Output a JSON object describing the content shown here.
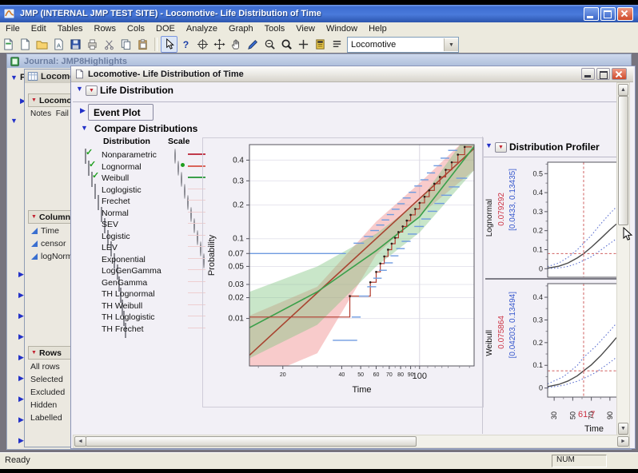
{
  "app": {
    "title": "JMP (INTERNAL JMP TEST SITE)  - Locomotive- Life Distribution of Time"
  },
  "menu": {
    "items": [
      "File",
      "Edit",
      "Tables",
      "Rows",
      "Cols",
      "DOE",
      "Analyze",
      "Graph",
      "Tools",
      "View",
      "Window",
      "Help"
    ]
  },
  "toolbar": {
    "table_selector_value": "Locomotive",
    "buttons": [
      {
        "name": "new-journal-button",
        "icon": "page-journal"
      },
      {
        "name": "new-data-table-button",
        "icon": "page"
      },
      {
        "name": "open-button",
        "icon": "folder"
      },
      {
        "name": "open-script-button",
        "icon": "page-a"
      },
      {
        "name": "save-button",
        "icon": "save"
      },
      {
        "name": "print-button",
        "icon": "print"
      },
      {
        "name": "cut-button",
        "icon": "scissors"
      },
      {
        "name": "copy-button",
        "icon": "copy"
      },
      {
        "name": "paste-button",
        "icon": "paste"
      },
      {
        "separator": true
      },
      {
        "name": "arrow-tool-button",
        "icon": "cursor",
        "selected": true
      },
      {
        "name": "help-tool-button",
        "icon": "help"
      },
      {
        "name": "crosshair-tool-button",
        "icon": "crosshair"
      },
      {
        "name": "move-tool-button",
        "icon": "move"
      },
      {
        "name": "grabber-tool-button",
        "icon": "hand"
      },
      {
        "name": "brush-tool-button",
        "icon": "brush"
      },
      {
        "name": "zoom-out-tool-button",
        "icon": "magnify-minus"
      },
      {
        "name": "zoom-tool-button",
        "icon": "magnify"
      },
      {
        "name": "plus-tool-button",
        "icon": "plus"
      },
      {
        "name": "formula-tool-button",
        "icon": "calculator"
      },
      {
        "name": "annotate-tool-button",
        "icon": "annotate"
      },
      {
        "name": "lasso-tool-button",
        "icon": "lasso"
      },
      {
        "name": "oval-tool-button",
        "icon": "oval"
      }
    ]
  },
  "journal_window": {
    "title": "Journal: JMP8Highlights",
    "outline_root_label": "F"
  },
  "data_table_window": {
    "title": "Locomotive",
    "table_panel_title": "Locomotive",
    "notes_label": "Notes",
    "notes_value": "Fail",
    "columns_panel_title": "Columns",
    "columns": [
      "Time",
      "censor",
      "logNorm"
    ],
    "rows_panel_title": "Rows",
    "row_items": [
      "All rows",
      "Selected",
      "Excluded",
      "Hidden",
      "Labelled"
    ]
  },
  "report_window": {
    "title": "Locomotive- Life Distribution of Time",
    "section_life": "Life Distribution",
    "section_event": "Event Plot",
    "section_compare": "Compare Distributions",
    "section_profiler": "Distribution Profiler",
    "dist_header_distribution": "Distribution",
    "dist_header_scale": "Scale",
    "distributions": [
      {
        "label": "Nonparametric",
        "checked": true,
        "radio": true,
        "selected": false,
        "swatch": "#c0394b"
      },
      {
        "label": "Lognormal",
        "checked": true,
        "radio": true,
        "selected": true,
        "swatch": "#d96459"
      },
      {
        "label": "Weibull",
        "checked": true,
        "radio": true,
        "selected": false,
        "swatch": "#3aa04a"
      },
      {
        "label": "Loglogistic",
        "checked": false,
        "radio": true,
        "selected": false,
        "swatch": "#eeced0"
      },
      {
        "label": "Frechet",
        "checked": false,
        "radio": true,
        "selected": false,
        "swatch": "#eeced0"
      },
      {
        "label": "Normal",
        "checked": false,
        "radio": true,
        "selected": false,
        "swatch": "#eeced0"
      },
      {
        "label": "SEV",
        "checked": false,
        "radio": true,
        "selected": false,
        "swatch": "#eeced0"
      },
      {
        "label": "Logistic",
        "checked": false,
        "radio": true,
        "selected": false,
        "swatch": "#eeced0"
      },
      {
        "label": "LEV",
        "checked": false,
        "radio": true,
        "selected": false,
        "swatch": "#eeced0"
      },
      {
        "label": "Exponential",
        "checked": false,
        "radio": true,
        "selected": false,
        "swatch": "#eeced0"
      },
      {
        "label": "LogGenGamma",
        "checked": false,
        "radio": false,
        "selected": false,
        "swatch": "#eeced0"
      },
      {
        "label": "GenGamma",
        "checked": false,
        "radio": false,
        "selected": false,
        "swatch": "#eeced0"
      },
      {
        "label": "TH Lognormal",
        "checked": false,
        "radio": false,
        "selected": false,
        "swatch": "#eeced0"
      },
      {
        "label": "TH Weibull",
        "checked": false,
        "radio": false,
        "selected": false,
        "swatch": "#eeced0"
      },
      {
        "label": "TH Loglogistic",
        "checked": false,
        "radio": false,
        "selected": false,
        "swatch": "#eeced0"
      },
      {
        "label": "TH Frechet",
        "checked": false,
        "radio": false,
        "selected": false,
        "swatch": "#eeced0"
      }
    ]
  },
  "status_bar": {
    "left": "Ready",
    "num": "NUM"
  },
  "chart_data": [
    {
      "id": "life-distribution-probability-plot",
      "type": "line",
      "xlabel": "Time",
      "ylabel": "Probability",
      "x_scale": "log",
      "y_scale": "normal-quantile",
      "xlim": [
        13.5,
        190
      ],
      "ylim": [
        0.0016,
        0.48
      ],
      "x_ticks": [
        20,
        40,
        50,
        60,
        70,
        80,
        90,
        100
      ],
      "x_minor_ticks": [
        15,
        25,
        30,
        35,
        45,
        55,
        65,
        75,
        85,
        95,
        110,
        120,
        130,
        140,
        160,
        180
      ],
      "x_gridlines": [
        100
      ],
      "y_ticks": [
        0.01,
        0.02,
        0.03,
        0.05,
        0.07,
        0.1,
        0.2,
        0.3,
        0.4
      ],
      "series": [
        {
          "name": "Lognormal fit",
          "color": "#a8432f",
          "points": [
            [
              13.5,
              0.0025
            ],
            [
              190,
              0.46
            ]
          ]
        },
        {
          "name": "Weibull fit",
          "color": "#3aa04a",
          "points": [
            [
              13.5,
              0.0072
            ],
            [
              30,
              0.024
            ],
            [
              60,
              0.075
            ],
            [
              100,
              0.16
            ],
            [
              190,
              0.47
            ]
          ]
        }
      ],
      "bands": [
        {
          "name": "Lognormal 95% CI",
          "color": "rgba(238,130,132,0.42)",
          "points": [
            [
              13.5,
              0.0008,
              0.011
            ],
            [
              30,
              0.0027,
              0.028
            ],
            [
              60,
              0.068,
              0.145
            ],
            [
              100,
              0.165,
              0.29
            ],
            [
              190,
              0.35,
              0.55
            ]
          ]
        },
        {
          "name": "Weibull 95% CI",
          "color": "rgba(126,196,126,0.42)",
          "points": [
            [
              13.5,
              0.0022,
              0.024
            ],
            [
              30,
              0.008,
              0.05
            ],
            [
              60,
              0.05,
              0.112
            ],
            [
              100,
              0.115,
              0.215
            ],
            [
              190,
              0.35,
              0.58
            ]
          ]
        }
      ],
      "nonparametric_step": {
        "color": "#b03a2e",
        "dot_color": "#2a1f1a",
        "points": [
          [
            13.5,
            0.0105
          ],
          [
            44,
            0.0105
          ],
          [
            44,
            0.021
          ],
          [
            56,
            0.021
          ],
          [
            56,
            0.032
          ],
          [
            60,
            0.032
          ],
          [
            60,
            0.043
          ],
          [
            63,
            0.043
          ],
          [
            63,
            0.054
          ],
          [
            66,
            0.054
          ],
          [
            66,
            0.065
          ],
          [
            69,
            0.065
          ],
          [
            69,
            0.077
          ],
          [
            72,
            0.077
          ],
          [
            72,
            0.089
          ],
          [
            75,
            0.089
          ],
          [
            75,
            0.102
          ],
          [
            78,
            0.102
          ],
          [
            78,
            0.116
          ],
          [
            82,
            0.116
          ],
          [
            82,
            0.131
          ],
          [
            86,
            0.131
          ],
          [
            86,
            0.148
          ],
          [
            90,
            0.148
          ],
          [
            90,
            0.166
          ],
          [
            95,
            0.166
          ],
          [
            95,
            0.186
          ],
          [
            100,
            0.186
          ],
          [
            100,
            0.208
          ],
          [
            106,
            0.208
          ],
          [
            106,
            0.232
          ],
          [
            112,
            0.232
          ],
          [
            112,
            0.258
          ],
          [
            119,
            0.258
          ],
          [
            119,
            0.287
          ],
          [
            127,
            0.287
          ],
          [
            127,
            0.318
          ],
          [
            136,
            0.318
          ],
          [
            136,
            0.352
          ],
          [
            146,
            0.352
          ],
          [
            146,
            0.389
          ],
          [
            157,
            0.389
          ],
          [
            157,
            0.428
          ],
          [
            170,
            0.428
          ],
          [
            170,
            0.468
          ],
          [
            185,
            0.468
          ]
        ]
      },
      "pointwise_ci_segments": {
        "color": "#6f9be0",
        "upper": [
          [
            13.5,
            42,
            0.07
          ],
          [
            46,
            52,
            0.09
          ],
          [
            52,
            58,
            0.105
          ],
          [
            56,
            62,
            0.12
          ],
          [
            60,
            66,
            0.135
          ],
          [
            64,
            70,
            0.15
          ],
          [
            68,
            74,
            0.167
          ],
          [
            72,
            79,
            0.185
          ],
          [
            77,
            84,
            0.205
          ],
          [
            82,
            90,
            0.227
          ],
          [
            88,
            96,
            0.25
          ],
          [
            94,
            103,
            0.277
          ],
          [
            101,
            111,
            0.305
          ],
          [
            109,
            120,
            0.337
          ],
          [
            118,
            130,
            0.372
          ],
          [
            128,
            142,
            0.41
          ],
          [
            140,
            156,
            0.45
          ]
        ],
        "lower": [
          [
            36,
            48,
            0.0045
          ],
          [
            45,
            50,
            0.0105
          ],
          [
            49,
            55,
            0.021
          ],
          [
            54,
            60,
            0.028
          ],
          [
            58,
            64,
            0.036
          ],
          [
            62,
            68,
            0.045
          ],
          [
            66,
            73,
            0.055
          ],
          [
            71,
            78,
            0.066
          ],
          [
            76,
            84,
            0.079
          ],
          [
            81,
            90,
            0.094
          ],
          [
            87,
            97,
            0.111
          ],
          [
            94,
            105,
            0.131
          ],
          [
            102,
            114,
            0.153
          ],
          [
            110,
            123,
            0.178
          ],
          [
            119,
            134,
            0.206
          ],
          [
            129,
            146,
            0.238
          ],
          [
            141,
            160,
            0.273
          ],
          [
            154,
            175,
            0.312
          ]
        ]
      }
    },
    {
      "id": "profiler-lognormal",
      "type": "line",
      "panel": "Lognormal",
      "estimate_label": "0.079292",
      "ci_label": "[0.0433, 0.13435]",
      "estimate_color": "#cc3344",
      "ci_color": "#3355cc",
      "xlim": [
        23,
        97
      ],
      "ylim": [
        -0.045,
        0.56
      ],
      "y_ticks": [
        0,
        0.1,
        0.2,
        0.3,
        0.4,
        0.5
      ],
      "crosshair": {
        "x": 61.7,
        "y": 0.079292
      },
      "curve": [
        [
          23,
          0.003
        ],
        [
          35,
          0.013
        ],
        [
          45,
          0.03
        ],
        [
          55,
          0.057
        ],
        [
          61.7,
          0.0793
        ],
        [
          70,
          0.113
        ],
        [
          80,
          0.158
        ],
        [
          90,
          0.205
        ],
        [
          97,
          0.235
        ]
      ],
      "ci_upper": [
        [
          23,
          0.011
        ],
        [
          35,
          0.03
        ],
        [
          45,
          0.06
        ],
        [
          55,
          0.1
        ],
        [
          61.7,
          0.1344
        ],
        [
          70,
          0.175
        ],
        [
          80,
          0.235
        ],
        [
          90,
          0.29
        ],
        [
          97,
          0.325
        ]
      ],
      "ci_lower": [
        [
          23,
          0.001
        ],
        [
          35,
          0.004
        ],
        [
          45,
          0.012
        ],
        [
          55,
          0.028
        ],
        [
          61.7,
          0.0433
        ],
        [
          70,
          0.063
        ],
        [
          80,
          0.097
        ],
        [
          90,
          0.133
        ],
        [
          97,
          0.157
        ]
      ]
    },
    {
      "id": "profiler-weibull",
      "type": "line",
      "panel": "Weibull",
      "estimate_label": "0.075864",
      "ci_label": "[0.04203, 0.13494]",
      "estimate_color": "#cc3344",
      "ci_color": "#3355cc",
      "xlim": [
        23,
        97
      ],
      "ylim": [
        -0.04,
        0.46
      ],
      "y_ticks": [
        0,
        0.1,
        0.2,
        0.3,
        0.4
      ],
      "x_ticks": [
        30,
        50,
        70,
        90
      ],
      "x_minor_ticks": [
        40,
        60,
        80
      ],
      "xlabel": "Time",
      "x_value_label": "61.7",
      "crosshair": {
        "x": 61.7,
        "y": 0.075864
      },
      "curve": [
        [
          23,
          0.006
        ],
        [
          35,
          0.016
        ],
        [
          45,
          0.031
        ],
        [
          55,
          0.054
        ],
        [
          61.7,
          0.0759
        ],
        [
          70,
          0.102
        ],
        [
          80,
          0.142
        ],
        [
          90,
          0.188
        ],
        [
          97,
          0.222
        ]
      ],
      "ci_upper": [
        [
          23,
          0.018
        ],
        [
          40,
          0.05
        ],
        [
          55,
          0.1
        ],
        [
          61.7,
          0.135
        ],
        [
          75,
          0.185
        ],
        [
          90,
          0.252
        ],
        [
          97,
          0.285
        ]
      ],
      "ci_lower": [
        [
          23,
          0.002
        ],
        [
          40,
          0.012
        ],
        [
          55,
          0.03
        ],
        [
          61.7,
          0.042
        ],
        [
          75,
          0.069
        ],
        [
          90,
          0.113
        ],
        [
          97,
          0.135
        ]
      ]
    }
  ]
}
